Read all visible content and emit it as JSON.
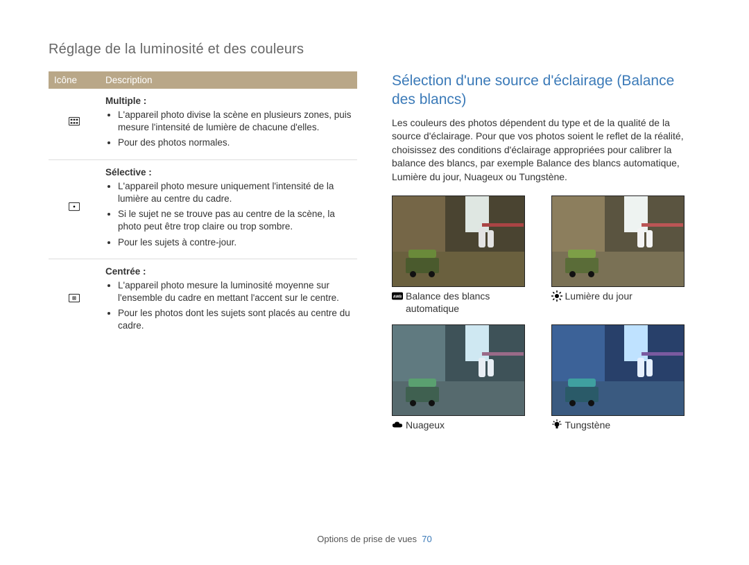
{
  "section_title": "Réglage de la luminosité et des couleurs",
  "table": {
    "headers": {
      "icon": "Icône",
      "desc": "Description"
    },
    "rows": [
      {
        "title": "Multiple :",
        "bullets": [
          "L'appareil photo divise la scène en plusieurs zones, puis mesure l'intensité de lumière de chacune d'elles.",
          "Pour des photos normales."
        ]
      },
      {
        "title": "Sélective :",
        "bullets": [
          "L'appareil photo mesure uniquement l'intensité de la lumière au centre du cadre.",
          "Si le sujet ne se trouve pas au centre de la scène, la photo peut être trop claire ou trop sombre.",
          "Pour les sujets à contre-jour."
        ]
      },
      {
        "title": "Centrée :",
        "bullets": [
          "L'appareil photo mesure la luminosité moyenne sur l'ensemble du cadre en mettant l'accent sur le centre.",
          "Pour les photos dont les sujets sont placés au centre du cadre."
        ]
      }
    ]
  },
  "right": {
    "heading": "Sélection d'une source d'éclairage (Balance des blancs)",
    "intro": "Les couleurs des photos dépendent du type et de la qualité de la source d'éclairage. Pour que vos photos soient le reflet de la réalité, choisissez des conditions d'éclairage appropriées pour calibrer la balance des blancs, par exemple Balance des blancs automatique, Lumière du jour, Nuageux ou Tungstène.",
    "items": [
      {
        "label": "Balance des blancs automatique",
        "icon": "awb"
      },
      {
        "label": "Lumière du jour",
        "icon": "sun"
      },
      {
        "label": "Nuageux",
        "icon": "cloud"
      },
      {
        "label": "Tungstène",
        "icon": "bulb"
      }
    ]
  },
  "footer": {
    "text": "Options de prise de vues",
    "page": "70"
  },
  "scene_variants": [
    {
      "floor": "#6a603e",
      "wall_l": "#756647",
      "wall_r": "#4a4431",
      "sky": "#dfe7e2",
      "cart_body": "#4a5a2d",
      "cart_top": "#6a8a3a",
      "awning": "#a44",
      "person": "#e3e3e3"
    },
    {
      "floor": "#7a7155",
      "wall_l": "#8c7e5d",
      "wall_r": "#5a5440",
      "sky": "#eef3f1",
      "cart_body": "#5a6c38",
      "cart_top": "#7d9f47",
      "awning": "#b55",
      "person": "#f4f4f4"
    },
    {
      "floor": "#566a6e",
      "wall_l": "#607a80",
      "wall_r": "#3e5258",
      "sky": "#cfe8f2",
      "cart_body": "#3f6050",
      "cart_top": "#5aa070",
      "awning": "#9a6a88",
      "person": "#e8eef4"
    },
    {
      "floor": "#3a5a80",
      "wall_l": "#3c6298",
      "wall_r": "#28406a",
      "sky": "#bfe2ff",
      "cart_body": "#2a5a68",
      "cart_top": "#3fa0a0",
      "awning": "#7a5aa0",
      "person": "#e6f0ff"
    }
  ]
}
